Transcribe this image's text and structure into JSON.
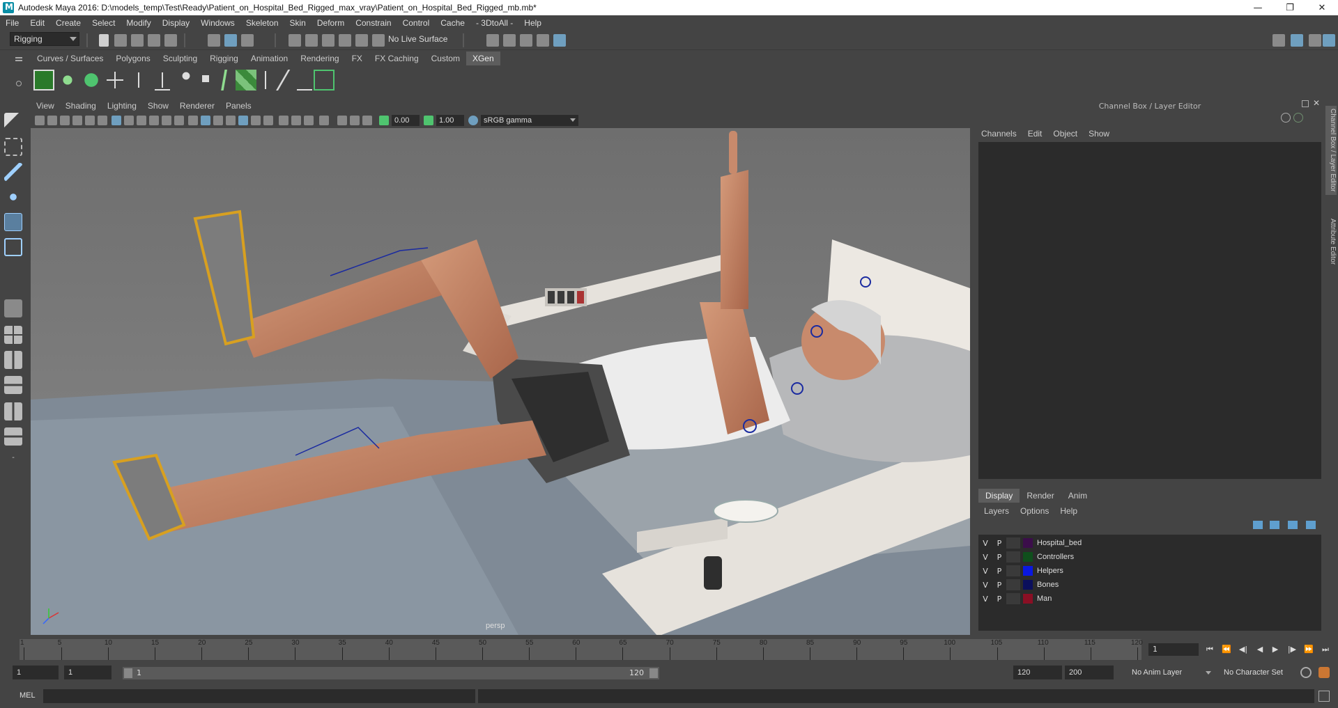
{
  "window": {
    "title": "Autodesk Maya 2016: D:\\models_temp\\Test\\Ready\\Patient_on_Hospital_Bed_Rigged_max_vray\\Patient_on_Hospital_Bed_Rigged_mb.mb*",
    "minimize": "—",
    "restore": "❐",
    "close": "✕"
  },
  "menubar": [
    "File",
    "Edit",
    "Create",
    "Select",
    "Modify",
    "Display",
    "Windows",
    "Skeleton",
    "Skin",
    "Deform",
    "Constrain",
    "Control",
    "Cache",
    "- 3DtoAll -",
    "Help"
  ],
  "statusline": {
    "mode": "Rigging",
    "live_surface": "No Live Surface"
  },
  "shelf_tabs": [
    "Curves / Surfaces",
    "Polygons",
    "Sculpting",
    "Rigging",
    "Animation",
    "Rendering",
    "FX",
    "FX Caching",
    "Custom",
    "XGen"
  ],
  "shelf_active": "XGen",
  "viewport": {
    "menu": [
      "View",
      "Shading",
      "Lighting",
      "Show",
      "Renderer",
      "Panels"
    ],
    "exposure": "0.00",
    "gamma": "1.00",
    "colorspace": "sRGB gamma",
    "camera_label": "persp"
  },
  "channel_box": {
    "title": "Channel Box / Layer Editor",
    "menu": [
      "Channels",
      "Edit",
      "Object",
      "Show"
    ]
  },
  "layer_editor": {
    "tabs": [
      "Display",
      "Render",
      "Anim"
    ],
    "active_tab": "Display",
    "menu": [
      "Layers",
      "Options",
      "Help"
    ],
    "layers": [
      {
        "v": "V",
        "p": "P",
        "name": "Hospital_bed",
        "color": "#3b0e4a"
      },
      {
        "v": "V",
        "p": "P",
        "name": "Controllers",
        "color": "#0f4f1c"
      },
      {
        "v": "V",
        "p": "P",
        "name": "Helpers",
        "color": "#0a18e0"
      },
      {
        "v": "V",
        "p": "P",
        "name": "Bones",
        "color": "#0b0f5c"
      },
      {
        "v": "V",
        "p": "P",
        "name": "Man",
        "color": "#8a0f24"
      }
    ]
  },
  "side_tabs": [
    "Channel Box / Layer Editor",
    "Attribute Editor"
  ],
  "timeslider": {
    "ticks": [
      5,
      10,
      15,
      20,
      25,
      30,
      35,
      40,
      45,
      50,
      55,
      60,
      65,
      70,
      75,
      80,
      85,
      90,
      95,
      100,
      105,
      110,
      115,
      120
    ],
    "first_tick": "1",
    "current_frame": "1",
    "range_max": 120
  },
  "range": {
    "start": "1",
    "playback_start": "1",
    "slider_start": "1",
    "slider_end": "120",
    "playback_end": "120",
    "end": "200",
    "anim_layer": "No Anim Layer",
    "character_set": "No Character Set"
  },
  "command_line": {
    "label": "MEL"
  },
  "colors": {
    "panel_bg": "#444444",
    "field_bg": "#2b2b2b",
    "active_tab": "#5d5d5d",
    "accent": "#6f9fbf"
  }
}
